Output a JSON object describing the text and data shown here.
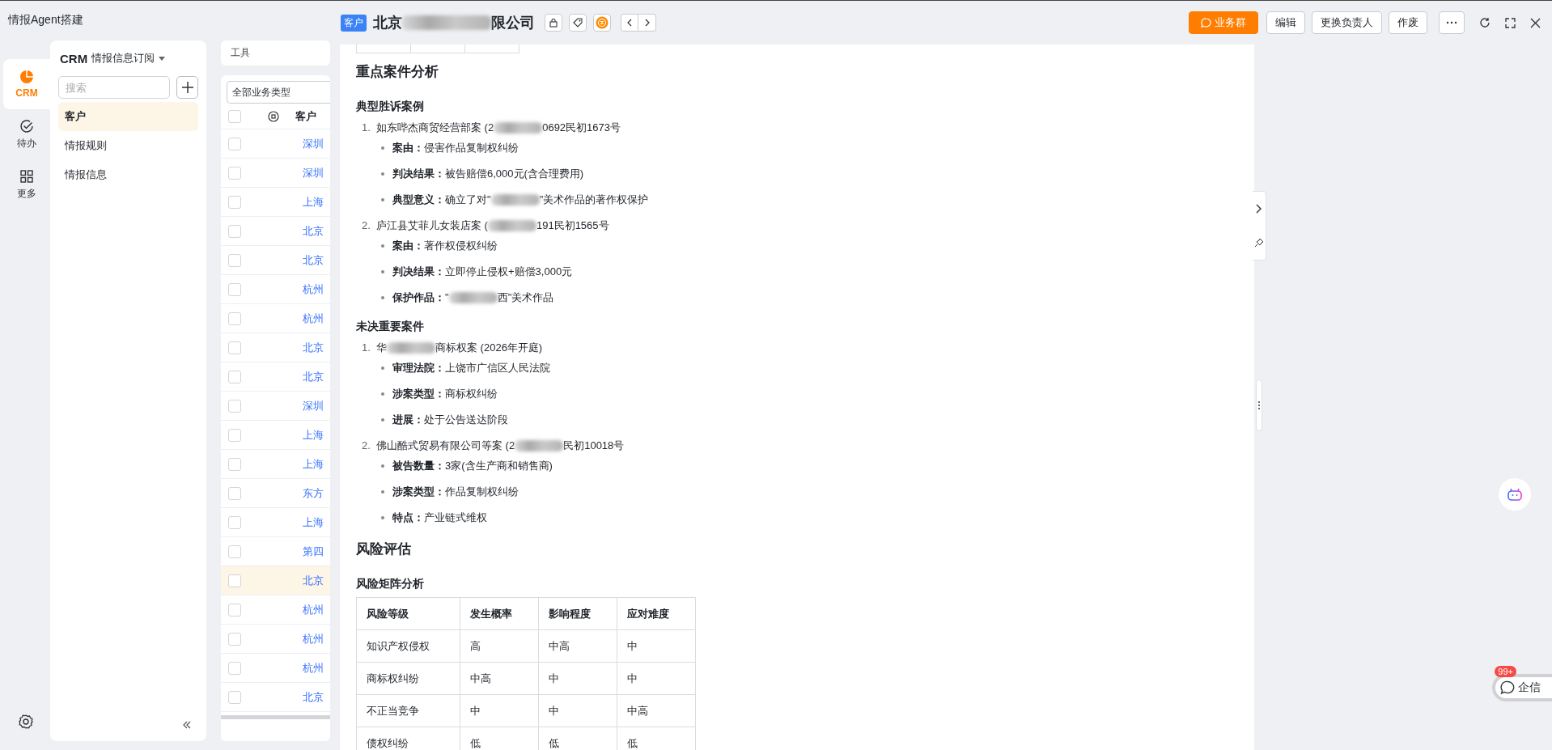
{
  "app": {
    "title": "情报Agent搭建"
  },
  "rail": [
    {
      "label": "CRM",
      "selected": true
    },
    {
      "label": "待办",
      "selected": false
    },
    {
      "label": "更多",
      "selected": false
    }
  ],
  "nav": {
    "brand": "CRM",
    "title": "情报信息订阅",
    "search": {
      "placeholder": "搜索"
    },
    "items": [
      {
        "label": "客户",
        "selected": true
      },
      {
        "label": "情报规则",
        "selected": false
      },
      {
        "label": "情报信息",
        "selected": false
      }
    ]
  },
  "toolbar": {
    "label": "工具"
  },
  "list": {
    "filter": "全部业务类型",
    "header": "客户",
    "header_checked": false,
    "rows": [
      {
        "name": "深圳",
        "checked": false,
        "selected": false
      },
      {
        "name": "深圳",
        "checked": false,
        "selected": false
      },
      {
        "name": "上海",
        "checked": false,
        "selected": false
      },
      {
        "name": "北京",
        "checked": false,
        "selected": false
      },
      {
        "name": "北京",
        "checked": false,
        "selected": false
      },
      {
        "name": "杭州",
        "checked": false,
        "selected": false
      },
      {
        "name": "杭州",
        "checked": false,
        "selected": false
      },
      {
        "name": "北京",
        "checked": false,
        "selected": false
      },
      {
        "name": "北京",
        "checked": false,
        "selected": false
      },
      {
        "name": "深圳",
        "checked": false,
        "selected": false
      },
      {
        "name": "上海",
        "checked": false,
        "selected": false
      },
      {
        "name": "上海",
        "checked": false,
        "selected": false
      },
      {
        "name": "东方",
        "checked": false,
        "selected": false
      },
      {
        "name": "上海",
        "checked": false,
        "selected": false
      },
      {
        "name": "第四",
        "checked": false,
        "selected": false
      },
      {
        "name": "北京",
        "checked": false,
        "selected": true
      },
      {
        "name": "杭州",
        "checked": false,
        "selected": false
      },
      {
        "name": "杭州",
        "checked": false,
        "selected": false
      },
      {
        "name": "杭州",
        "checked": false,
        "selected": false
      },
      {
        "name": "北京",
        "checked": false,
        "selected": false
      }
    ]
  },
  "drawer": {
    "tag": "客户",
    "title": [
      {
        "kind": "text",
        "text": "北京"
      },
      {
        "kind": "redacted"
      },
      {
        "kind": "text",
        "text": "限公司"
      }
    ],
    "actions": [
      {
        "label": "业务群",
        "kind": "primary"
      },
      {
        "label": "编辑",
        "kind": "default"
      },
      {
        "label": "更换负责人",
        "kind": "default"
      },
      {
        "label": "作废",
        "kind": "default"
      }
    ],
    "sections": [
      {
        "kind": "h2",
        "text": "重点案件分析"
      },
      {
        "kind": "h3",
        "text": "典型胜诉案例"
      },
      {
        "kind": "list",
        "items": [
          {
            "number": "1.",
            "title": [
              {
                "kind": "text",
                "text": "如东哔杰商贸经营部案 (2"
              },
              {
                "kind": "redacted"
              },
              {
                "kind": "text",
                "text": "0692民初1673号"
              }
            ],
            "bullets": [
              [
                {
                  "kind": "text",
                  "text": "**案由：**侵害作品复制权纠纷"
                }
              ],
              [
                {
                  "kind": "text",
                  "text": "**判决结果：**被告赔偿6,000元(含合理费用)"
                }
              ],
              [
                {
                  "kind": "text",
                  "text": "**典型意义：**确立了对\""
                },
                {
                  "kind": "redacted"
                },
                {
                  "kind": "text",
                  "text": "\"美术作品的著作权保护"
                }
              ]
            ]
          },
          {
            "number": "2.",
            "title": [
              {
                "kind": "text",
                "text": "庐江县艾菲儿女装店案 ("
              },
              {
                "kind": "redacted"
              },
              {
                "kind": "text",
                "text": "191民初1565号"
              }
            ],
            "bullets": [
              [
                {
                  "kind": "text",
                  "text": "**案由：**著作权侵权纠纷"
                }
              ],
              [
                {
                  "kind": "text",
                  "text": "**判决结果：**立即停止侵权+赔偿3,000元"
                }
              ],
              [
                {
                  "kind": "text",
                  "text": "**保护作品：**\""
                },
                {
                  "kind": "redacted"
                },
                {
                  "kind": "text",
                  "text": "西\"美术作品"
                }
              ]
            ]
          }
        ]
      },
      {
        "kind": "h3",
        "text": "未决重要案件"
      },
      {
        "kind": "list",
        "items": [
          {
            "number": "1.",
            "title": [
              {
                "kind": "text",
                "text": "华"
              },
              {
                "kind": "redacted"
              },
              {
                "kind": "text",
                "text": "商标权案 (2026年开庭)"
              }
            ],
            "bullets": [
              [
                {
                  "kind": "text",
                  "text": "**审理法院：**上饶市广信区人民法院"
                }
              ],
              [
                {
                  "kind": "text",
                  "text": "**涉案类型：**商标权纠纷"
                }
              ],
              [
                {
                  "kind": "text",
                  "text": "**进展：**处于公告送达阶段"
                }
              ]
            ]
          },
          {
            "number": "2.",
            "title": [
              {
                "kind": "text",
                "text": "佛山酷式贸易有限公司等案 (2"
              },
              {
                "kind": "redacted"
              },
              {
                "kind": "text",
                "text": "民初10018号"
              }
            ],
            "bullets": [
              [
                {
                  "kind": "text",
                  "text": "**被告数量：**3家(含生产商和销售商)"
                }
              ],
              [
                {
                  "kind": "text",
                  "text": "**涉案类型：**作品复制权纠纷"
                }
              ],
              [
                {
                  "kind": "text",
                  "text": "**特点：**产业链式维权"
                }
              ]
            ]
          }
        ]
      },
      {
        "kind": "h2",
        "text": "风险评估"
      },
      {
        "kind": "h3",
        "text": "风险矩阵分析"
      },
      {
        "kind": "table",
        "columns": [
          "风险等级",
          "发生概率",
          "影响程度",
          "应对难度"
        ],
        "rows": [
          [
            "知识产权侵权",
            "高",
            "中高",
            "中"
          ],
          [
            "商标权纠纷",
            "中高",
            "中",
            "中"
          ],
          [
            "不正当竞争",
            "中",
            "中",
            "中高"
          ],
          [
            "债权纠纷",
            "低",
            "低",
            "低"
          ]
        ]
      }
    ]
  },
  "chat": {
    "badge": "99+",
    "label": "企信"
  }
}
